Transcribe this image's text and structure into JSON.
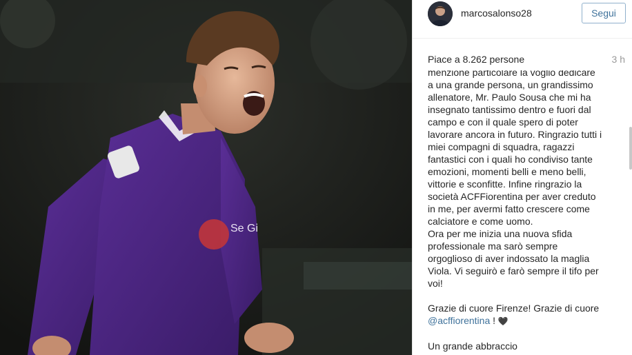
{
  "header": {
    "username": "marcosalonso28",
    "follow_label": "Segui"
  },
  "meta": {
    "likes": "Piace a 8.262 persone",
    "time": "3 h"
  },
  "caption": {
    "lines": [
      "menzione particolare la voglio dedicare",
      "a una grande persona, un grandissimo",
      "allenatore, Mr. Paulo Sousa che mi ha",
      "insegnato tantissimo dentro e fuori dal",
      "campo e con il quale spero di poter",
      "lavorare ancora in futuro. Ringrazio tutti i",
      "miei compagni di squadra, ragazzi",
      "fantastici con i quali ho condiviso tante",
      "emozioni, momenti belli e meno belli,",
      "vittorie e sconfitte. Infine ringrazio la",
      "società ACFFiorentina per aver creduto",
      "in me, per avermi fatto crescere come",
      "calciatore e come uomo.",
      "Ora per me inizia una nuova sfida",
      "professionale ma sarò sempre",
      "orgoglioso di aver indossato la maglia",
      "Viola. Vi seguirò e farò sempre il tifo per",
      "voi!",
      "",
      "Grazie di cuore Firenze! Grazie di cuore"
    ],
    "mention": "@acffiorentina",
    "mention_suffix": " ! ",
    "heart_glyph": "🖤",
    "closing": "Un grande abbraccio"
  },
  "photo": {
    "jersey_text": "Se Gi",
    "colors": {
      "jersey": "#4a2580",
      "background": "#1b1c1a",
      "skin": "#d9a98c",
      "hair": "#5a3a22"
    }
  },
  "colors": {
    "link": "#3f729b",
    "text": "#262626",
    "muted": "#999999"
  }
}
